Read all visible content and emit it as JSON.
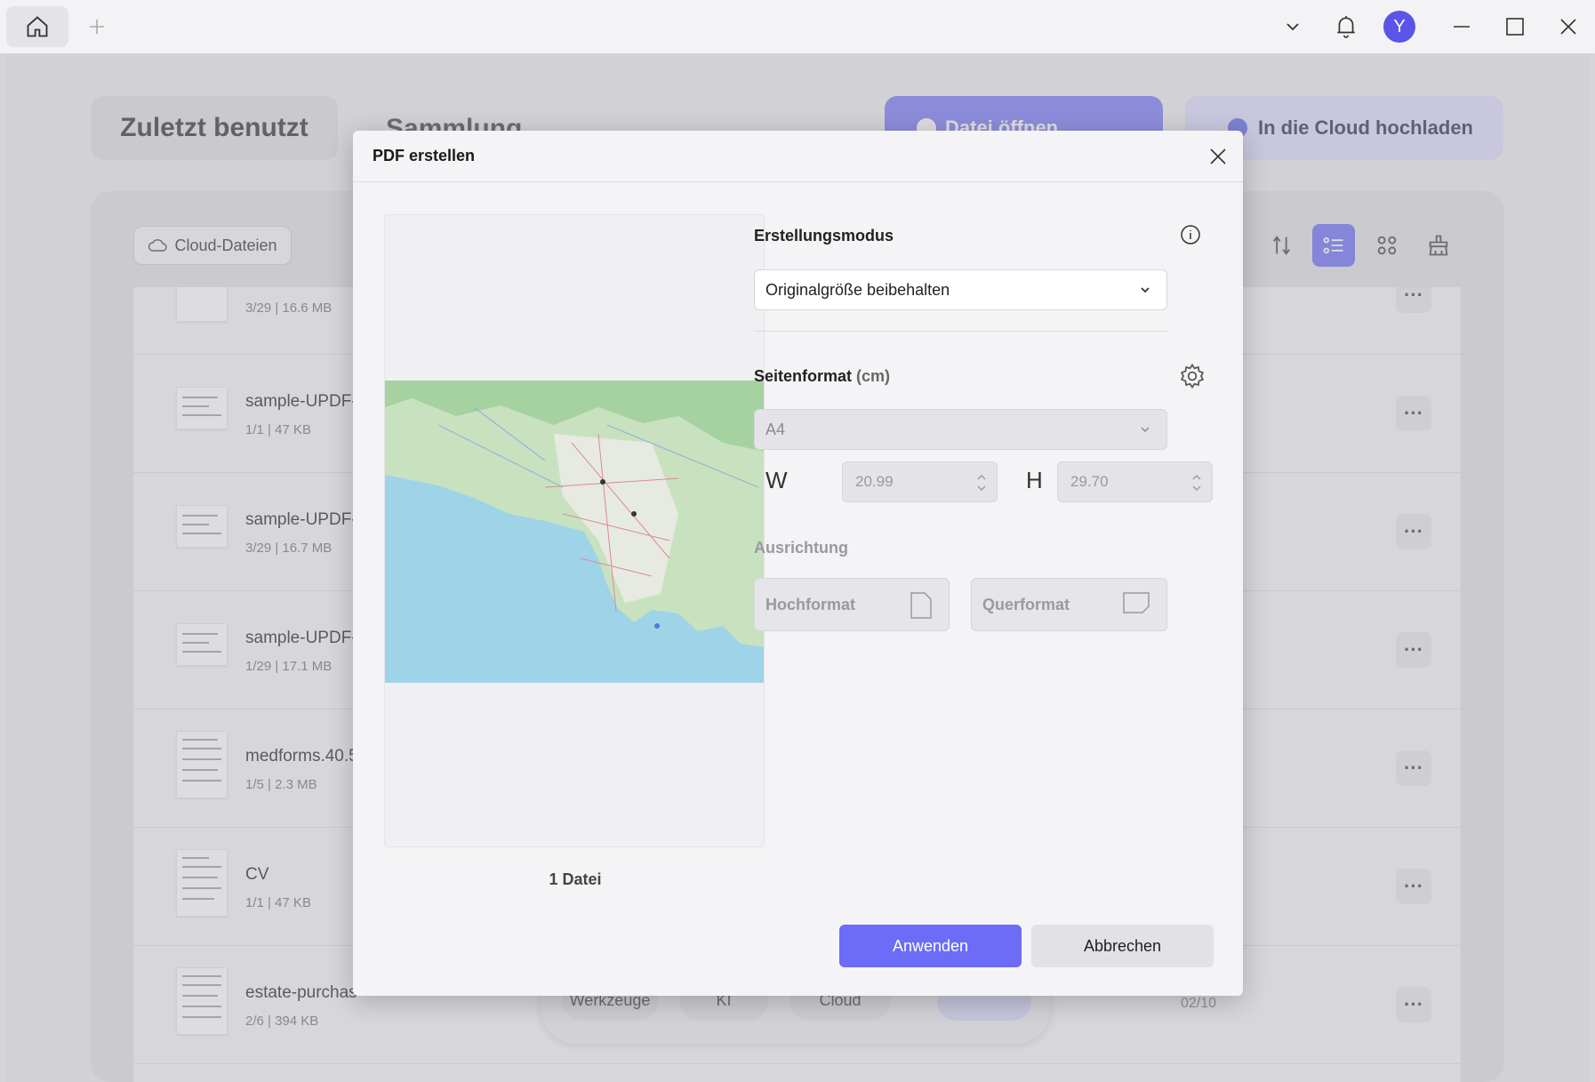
{
  "window": {
    "user_initial": "Y"
  },
  "nav": {
    "recent_tab": "Zuletzt benutzt",
    "collection_tab": "Sammlung",
    "open_file": "Datei öffnen",
    "upload_cloud": "In die Cloud hochladen",
    "cloud_files": "Cloud-Dateien"
  },
  "files": [
    {
      "name": "",
      "meta": "3/29 | 16.6 MB"
    },
    {
      "name": "sample-UPDF-s",
      "meta": "1/1 | 47 KB"
    },
    {
      "name": "sample-UPDF-s",
      "meta": "3/29 | 16.7 MB"
    },
    {
      "name": "sample-UPDF-c",
      "meta": "1/29 | 17.1 MB"
    },
    {
      "name": "medforms.40.5",
      "meta": "1/5 | 2.3 MB"
    },
    {
      "name": "CV",
      "meta": "1/1 | 47 KB"
    },
    {
      "name": "estate-purchas",
      "meta": "2/6 | 394 KB",
      "date": "02/10"
    }
  ],
  "dock": {
    "tools": "Werkzeuge",
    "ai": "KI",
    "cloud": "Cloud"
  },
  "dialog": {
    "title": "PDF erstellen",
    "creation_mode_label": "Erstellungsmodus",
    "creation_mode_value": "Originalgröße beibehalten",
    "page_format_label": "Seitenformat",
    "page_format_unit": "(cm)",
    "page_format_value": "A4",
    "width_label": "W",
    "width_value": "20.99",
    "height_label": "H",
    "height_value": "29.70",
    "orientation_label": "Ausrichtung",
    "portrait": "Hochformat",
    "landscape": "Querformat",
    "file_count": "1 Datei",
    "apply": "Anwenden",
    "cancel": "Abbrechen"
  },
  "colors": {
    "accent": "#6c6cf7",
    "avatar": "#5b54e8",
    "cloud_button_bg": "#d9d8fb"
  }
}
